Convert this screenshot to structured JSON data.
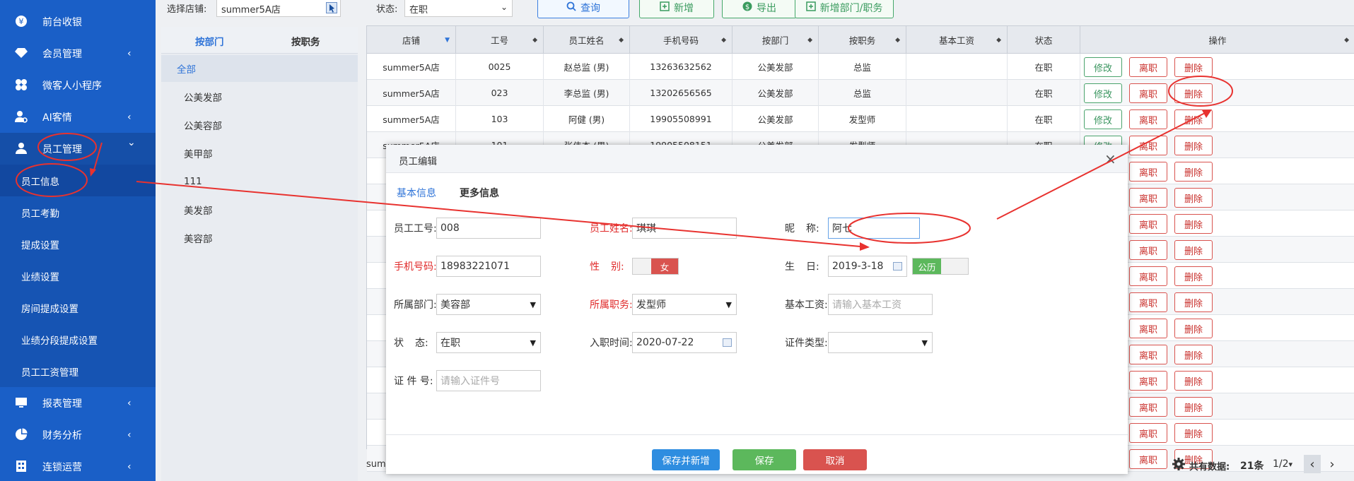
{
  "sidebar": {
    "items": [
      {
        "label": "前台收银",
        "icon": "yen-coin-icon"
      },
      {
        "label": "会员管理",
        "icon": "diamond-icon",
        "arrow": "‹"
      },
      {
        "label": "微客人小程序",
        "icon": "flower-icon"
      },
      {
        "label": "AI客情",
        "icon": "user-cog-icon",
        "arrow": "‹"
      },
      {
        "label": "员工管理",
        "icon": "user-icon",
        "arrow": "⌄"
      }
    ],
    "sub_items": [
      "员工信息",
      "员工考勤",
      "提成设置",
      "业绩设置",
      "房间提成设置",
      "业绩分段提成设置",
      "员工工资管理"
    ],
    "bottom_items": [
      {
        "label": "报表管理",
        "icon": "monitor-icon",
        "arrow": "‹"
      },
      {
        "label": "财务分析",
        "icon": "pie-chart-icon",
        "arrow": "‹"
      },
      {
        "label": "连锁运营",
        "icon": "building-icon",
        "arrow": "‹"
      }
    ]
  },
  "toolbar": {
    "store_label": "选择店铺:",
    "store_value": "summer5A店",
    "status_label": "状态:",
    "status_value": "在职",
    "query_label": "查询",
    "add_label": "新增",
    "export_label": "导出",
    "add_dept_label": "新增部门/职务"
  },
  "dept_panel": {
    "tabs": [
      "按部门",
      "按职务"
    ],
    "items": [
      "全部",
      "公美发部",
      "公美容部",
      "美甲部",
      "111",
      "美发部",
      "美容部"
    ]
  },
  "grid": {
    "columns": [
      "店铺",
      "工号",
      "员工姓名",
      "手机号码",
      "按部门",
      "按职务",
      "基本工资",
      "状态",
      "操作"
    ],
    "rows": [
      [
        "summer5A店",
        "0025",
        "赵总监 (男)",
        "13263632562",
        "公美发部",
        "总监",
        "",
        "在职"
      ],
      [
        "summer5A店",
        "023",
        "李总监 (男)",
        "13202656565",
        "公美发部",
        "总监",
        "",
        "在职"
      ],
      [
        "summer5A店",
        "103",
        "阿健 (男)",
        "19905508991",
        "公美发部",
        "发型师",
        "",
        "在职"
      ],
      [
        "summer5A店",
        "101",
        "张伟杰 (男)",
        "19905508151",
        "公美发部",
        "发型师",
        "",
        "在职"
      ]
    ],
    "status_rest": "在职",
    "action_edit": "修改",
    "action_leave": "离职",
    "action_delete": "删除"
  },
  "footer": {
    "store_clip": "sum",
    "total_label": "共有数据:",
    "total_value": "21条",
    "page": "1/2",
    "page_caret": "▾",
    "prev": "‹",
    "next": "›"
  },
  "dialog": {
    "title": "员工编辑",
    "close": "×",
    "tab_basic": "基本信息",
    "tab_more": "更多信息",
    "emp_no_label": "员工工号:",
    "emp_no_value": "008",
    "name_label": "员工姓名:",
    "name_value": "琪琪",
    "nick_label_1": "昵",
    "nick_label_2": "称:",
    "nick_value": "阿七",
    "phone_label": "手机号码:",
    "phone_value": "18983221071",
    "gender_label_1": "性",
    "gender_label_2": "别:",
    "gender_value": "女",
    "birth_label_1": "生",
    "birth_label_2": "日:",
    "birth_value": "2019-3-18",
    "calendar_type": "公历",
    "dept_label": "所属部门:",
    "dept_value": "美容部",
    "job_label": "所属职务:",
    "job_value": "发型师",
    "salary_label": "基本工资:",
    "salary_placeholder": "请输入基本工资",
    "status_label_1": "状",
    "status_label_2": "态:",
    "status_value": "在职",
    "join_label": "入职时间:",
    "join_value": "2020-07-22",
    "id_type_label": "证件类型:",
    "id_type_value": "",
    "id_no_label": "证 件 号:",
    "id_no_placeholder": "请输入证件号",
    "btn_save_new": "保存并新增",
    "btn_save": "保存",
    "btn_cancel": "取消"
  },
  "colors": {
    "sidebar": "#1a5fc7",
    "primary": "#2f74d8",
    "success": "#5cb85c",
    "danger": "#d9534f",
    "annotation": "#e8322f"
  }
}
